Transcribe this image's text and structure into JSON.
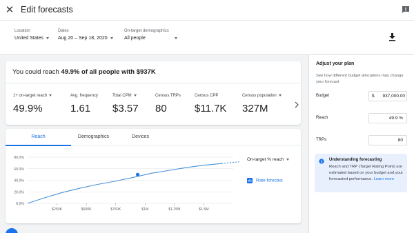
{
  "header": {
    "title": "Edit forecasts"
  },
  "filters": {
    "location": {
      "label": "Location",
      "value": "United States"
    },
    "dates": {
      "label": "Dates",
      "value": "Aug 20 – Sep 18, 2020"
    },
    "demographics": {
      "label": "On-target demographics",
      "value": "All people"
    }
  },
  "summary": {
    "prefix": "You could reach ",
    "percent": "49.9%",
    "middle": " of all people",
    "suffix": " with $937K"
  },
  "metrics": [
    {
      "label": "1+ on-target reach",
      "value": "49.9%",
      "dropdown": true
    },
    {
      "label": "Avg. frequency",
      "value": "1.61",
      "dropdown": false
    },
    {
      "label": "Total CPM",
      "value": "$3.57",
      "dropdown": true
    },
    {
      "label": "Census TRPs",
      "value": "80",
      "dropdown": false
    },
    {
      "label": "Census CPP",
      "value": "$11.7K",
      "dropdown": false
    },
    {
      "label": "Census population",
      "value": "327M",
      "dropdown": true
    }
  ],
  "tabs": [
    {
      "label": "Reach",
      "active": true
    },
    {
      "label": "Demographics",
      "active": false
    },
    {
      "label": "Devices",
      "active": false
    }
  ],
  "chart_select": "On-target % reach",
  "rate_forecast": "Rate forecast",
  "chart_data": {
    "type": "line",
    "x_ticks": [
      250000,
      500000,
      750000,
      1000000,
      1250000,
      1500000
    ],
    "x_tick_labels": [
      "$250K",
      "$500K",
      "$750K",
      "$1M",
      "$1.25M",
      "$1.5M"
    ],
    "y_ticks": [
      0,
      20,
      40,
      60,
      80
    ],
    "y_tick_labels": [
      "0.0%",
      "20.0%",
      "40.0%",
      "60.0%",
      "80.0%"
    ],
    "xlim": [
      0,
      1750000
    ],
    "ylim": [
      0,
      80
    ],
    "series": [
      {
        "x": [
          0,
          150000,
          300000,
          450000,
          600000,
          750000,
          900000,
          1050000,
          1200000,
          1350000,
          1500000,
          1650000
        ],
        "y": [
          0,
          10,
          19,
          26.5,
          33,
          38.5,
          45,
          52,
          57,
          62,
          66,
          69
        ],
        "forecast_x": [
          1650000,
          1800000
        ],
        "forecast_y": [
          69,
          72
        ]
      }
    ],
    "highlight": {
      "x": 937000,
      "y": 49.9
    },
    "grid": true,
    "colors": {
      "line": "#4a90d9",
      "grid": "#e0e0e0",
      "point": "#1a73e8"
    }
  },
  "plan": {
    "title": "Adjust your plan",
    "description": "See how different budget allocations may change your forecast",
    "budget_label": "Budget",
    "currency": "$",
    "budget_value": "937,000.00",
    "reach_label": "Reach",
    "reach_value": "49.9 %",
    "trps_label": "TRPs",
    "trps_value": "80",
    "info_title": "Understanding forecasting",
    "info_body": "Reach and TRP (Target Rating Point) are estimated based on your budget and your forecasted performance.",
    "info_link": "Learn more"
  }
}
